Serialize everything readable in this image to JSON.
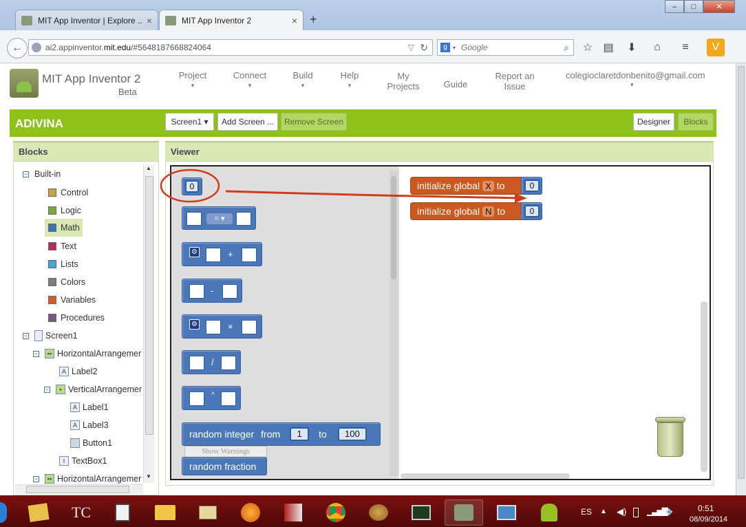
{
  "window_controls": {
    "minimize": "–",
    "maximize": "□",
    "close": "✕"
  },
  "tabs": [
    {
      "label": "MIT App Inventor | Explore ...",
      "close": "×"
    },
    {
      "label": "MIT App Inventor 2",
      "close": "×"
    }
  ],
  "new_tab": "+",
  "nav": {
    "url_prefix": "ai2.appinventor.",
    "url_domain": "mit.edu",
    "url_suffix": "/#5648187668824064",
    "search_placeholder": "Google",
    "search_engine": "g"
  },
  "app": {
    "title": "MIT App Inventor 2",
    "subtitle": "Beta",
    "menu": {
      "project": "Project",
      "connect": "Connect",
      "build": "Build",
      "help": "Help",
      "my_projects_1": "My",
      "my_projects_2": "Projects",
      "guide": "Guide",
      "report_1": "Report an",
      "report_2": "Issue",
      "caret": "▾"
    },
    "account": "colegioclaretdonbenito@gmail.com"
  },
  "toolbar": {
    "project_name": "ADIVINA",
    "screen_select": "Screen1 ▾",
    "add_screen": "Add Screen ...",
    "remove_screen": "Remove Screen",
    "designer": "Designer",
    "blocks": "Blocks"
  },
  "blocks_panel": {
    "title": "Blocks",
    "builtin": "Built-in",
    "categories": [
      {
        "label": "Control",
        "color": "#c7a24b"
      },
      {
        "label": "Logic",
        "color": "#77ab41"
      },
      {
        "label": "Math",
        "color": "#3f72b5"
      },
      {
        "label": "Text",
        "color": "#b32d5e"
      },
      {
        "label": "Lists",
        "color": "#49a6d4"
      },
      {
        "label": "Colors",
        "color": "#7d7d7d"
      },
      {
        "label": "Variables",
        "color": "#d05f2d"
      },
      {
        "label": "Procedures",
        "color": "#7c5385"
      }
    ],
    "components": {
      "screen": "Screen1",
      "harr1": "HorizontalArrangemer",
      "label2": "Label2",
      "varr": "VerticalArrangemer",
      "label1": "Label1",
      "label3": "Label3",
      "button1": "Button1",
      "textbox1": "TextBox1",
      "harr2": "HorizontalArrangemer"
    }
  },
  "viewer": {
    "title": "Viewer",
    "flyout": {
      "number": "0",
      "compare_op": "= ▾",
      "plus": "+",
      "minus": "-",
      "times": "×",
      "divide": "/",
      "power": "^",
      "random_integer": "random integer",
      "from": "from",
      "to": "to",
      "from_value": "1",
      "to_value": "100",
      "show_warnings": "Show Warnings",
      "random_fraction": "random fraction"
    },
    "workspace": [
      {
        "label": "initialize global",
        "var": "X",
        "to": "to",
        "value": "0"
      },
      {
        "label": "initialize global",
        "var": "N",
        "to": "to",
        "value": "0"
      }
    ]
  },
  "taskbar": {
    "lang": "ES",
    "time": "0:51",
    "date": "08/09/2014"
  },
  "colors": {
    "accent_green": "#8ec21a",
    "math_blue": "#4b77b9",
    "variable_orange": "#c9591f",
    "annotation_red": "#d23a1c"
  }
}
